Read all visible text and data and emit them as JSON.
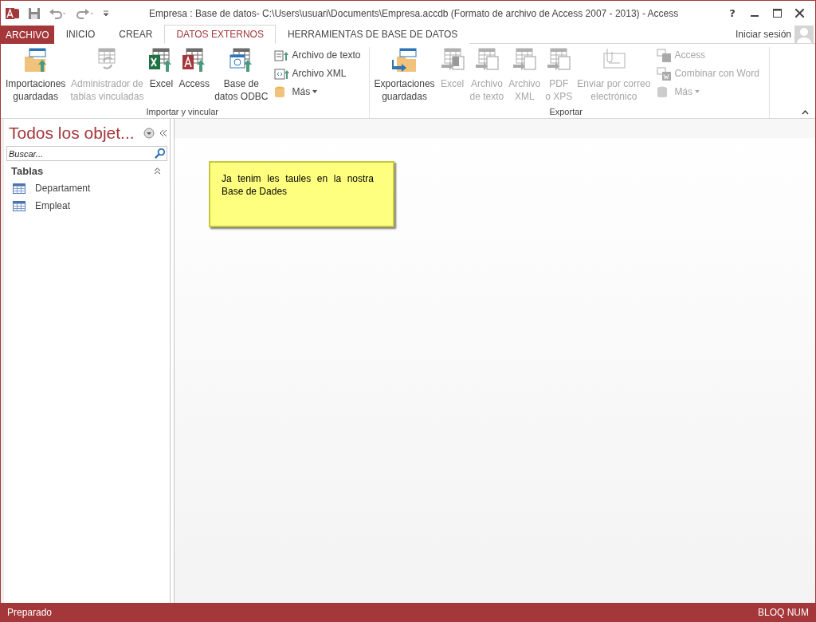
{
  "window": {
    "title": "Empresa : Base de datos- C:\\Users\\usuari\\Documents\\Empresa.accdb (Formato de archivo de Access 2007 - 2013) - Access",
    "help": "?"
  },
  "tabs": [
    {
      "label": "ARCHIVO",
      "kind": "file",
      "selected": false
    },
    {
      "label": "INICIO",
      "kind": "tab",
      "selected": false
    },
    {
      "label": "CREAR",
      "kind": "tab",
      "selected": false
    },
    {
      "label": "DATOS EXTERNOS",
      "kind": "tab",
      "selected": true
    },
    {
      "label": "HERRAMIENTAS DE BASE DE DATOS",
      "kind": "tab",
      "selected": false
    }
  ],
  "sign_in": "Iniciar sesión",
  "ribbon_groups": [
    {
      "label": "Importar y vincular",
      "large_buttons": [
        {
          "lines": [
            "Importaciones",
            "guardadas"
          ],
          "kind": "saved-import",
          "disabled": false
        },
        {
          "lines": [
            "Administrador de",
            "tablas vinculadas"
          ],
          "kind": "linked",
          "disabled": true
        },
        {
          "lines": [
            "Excel"
          ],
          "kind": "excel-import",
          "disabled": false
        },
        {
          "lines": [
            "Access"
          ],
          "kind": "access-import",
          "disabled": false
        },
        {
          "lines": [
            "Base de",
            "datos ODBC"
          ],
          "kind": "odbc",
          "disabled": false
        }
      ],
      "small_buttons": [
        {
          "label": "Archivo de texto",
          "kind": "text",
          "disabled": false,
          "dropdown": false
        },
        {
          "label": "Archivo XML",
          "kind": "xml",
          "disabled": false,
          "dropdown": false
        },
        {
          "label": "Más",
          "kind": "more",
          "disabled": false,
          "dropdown": true
        }
      ]
    },
    {
      "label": "Exportar",
      "large_buttons": [
        {
          "lines": [
            "Exportaciones",
            "guardadas"
          ],
          "kind": "saved-export",
          "disabled": false
        },
        {
          "lines": [
            "Excel"
          ],
          "kind": "excel-export",
          "disabled": true
        },
        {
          "lines": [
            "Archivo",
            "de texto"
          ],
          "kind": "text-export",
          "disabled": true
        },
        {
          "lines": [
            "Archivo",
            "XML"
          ],
          "kind": "xml-export",
          "disabled": true
        },
        {
          "lines": [
            "PDF",
            "o XPS"
          ],
          "kind": "pdf-export",
          "disabled": true
        },
        {
          "lines": [
            "Enviar por correo",
            "electrónico"
          ],
          "kind": "email",
          "disabled": true
        }
      ],
      "small_buttons": [
        {
          "label": "Access",
          "kind": "access",
          "disabled": true,
          "dropdown": false
        },
        {
          "label": "Combinar con Word",
          "kind": "word",
          "disabled": true,
          "dropdown": false
        },
        {
          "label": "Más",
          "kind": "more",
          "disabled": true,
          "dropdown": true
        }
      ]
    }
  ],
  "nav_pane": {
    "title": "Todos los objet...",
    "search": {
      "placeholder": "Buscar..."
    },
    "groups": [
      {
        "label": "Tablas",
        "expanded": true,
        "items": [
          "Departament",
          "Empleat"
        ]
      }
    ]
  },
  "note": {
    "text": "Ja tenim les taules en la nostra Base de Dades"
  },
  "status_bar": {
    "left": "Preparado",
    "right": "BLOQ NUM"
  }
}
